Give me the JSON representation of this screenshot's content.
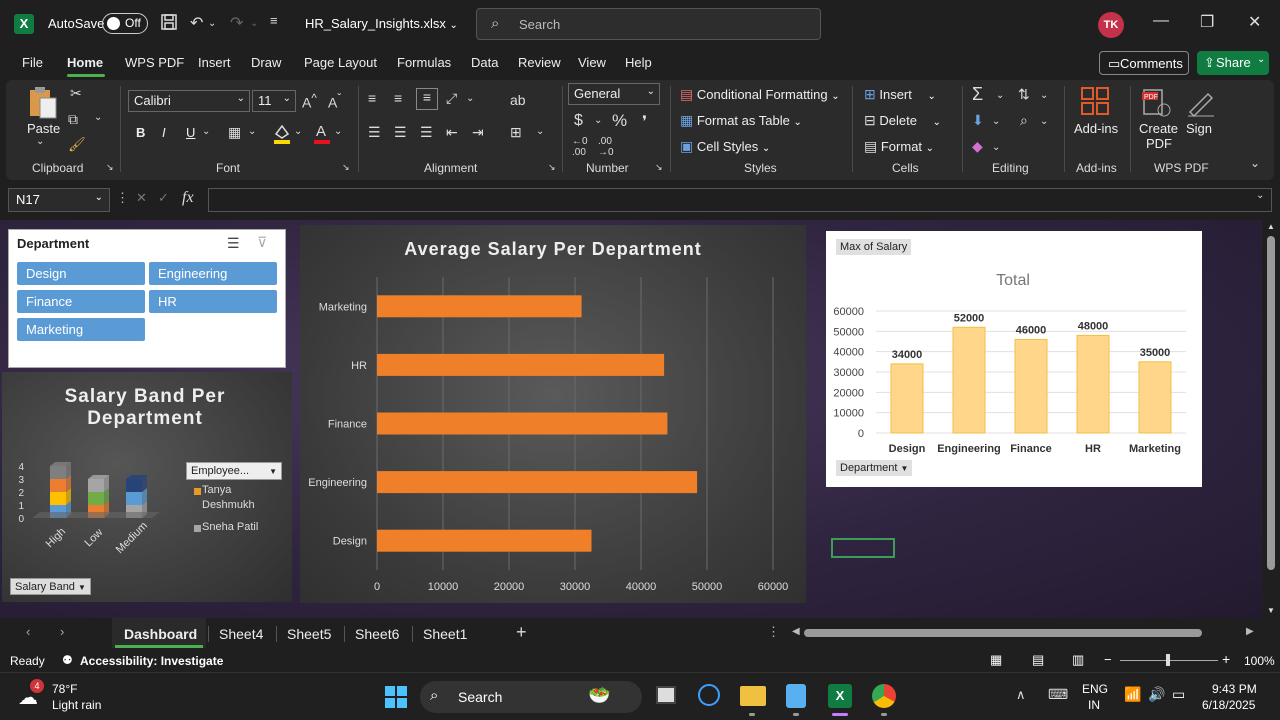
{
  "titlebar": {
    "autosave_label": "AutoSave",
    "autosave_state": "Off",
    "filename": "HR_Salary_Insights.xlsx",
    "search_placeholder": "Search",
    "avatar_initials": "TK"
  },
  "menu": {
    "items": [
      "File",
      "Home",
      "WPS PDF",
      "Insert",
      "Draw",
      "Page Layout",
      "Formulas",
      "Data",
      "Review",
      "View",
      "Help"
    ],
    "active": "Home",
    "comments_label": "Comments",
    "share_label": "Share"
  },
  "ribbon": {
    "clipboard": {
      "paste": "Paste",
      "label": "Clipboard"
    },
    "font": {
      "name": "Calibri",
      "size": "11",
      "label": "Font",
      "bold": "B",
      "italic": "I",
      "underline": "U"
    },
    "alignment": {
      "label": "Alignment"
    },
    "number": {
      "format": "General",
      "label": "Number"
    },
    "styles": {
      "conditional": "Conditional Formatting",
      "table": "Format as Table",
      "cell": "Cell Styles",
      "label": "Styles"
    },
    "cells": {
      "insert": "Insert",
      "delete": "Delete",
      "format": "Format",
      "label": "Cells"
    },
    "editing": {
      "label": "Editing"
    },
    "addins": {
      "button": "Add-ins",
      "label": "Add-ins"
    },
    "wpspdf": {
      "create": "Create",
      "pdf": "PDF",
      "sign": "Sign",
      "label": "WPS PDF"
    }
  },
  "formula_bar": {
    "name_box": "N17",
    "fx": "fx",
    "content": ""
  },
  "slicer": {
    "title": "Department",
    "items": [
      "Design",
      "Engineering",
      "Finance",
      "HR",
      "Marketing"
    ]
  },
  "chart1": {
    "title_line1": "Salary Band Per",
    "title_line2": "Department",
    "filter_label": "Employee...",
    "legend": [
      "Tanya",
      "Deshmukh",
      "Sneha Patil"
    ],
    "field_button": "Salary Band"
  },
  "chart3": {
    "field_button_top": "Max of Salary",
    "field_button_bottom": "Department"
  },
  "chart_data": [
    {
      "type": "bar",
      "orientation": "horizontal",
      "title": "Average Salary Per Department",
      "categories": [
        "Marketing",
        "HR",
        "Finance",
        "Engineering",
        "Design"
      ],
      "values": [
        31000,
        43500,
        44000,
        48500,
        32500
      ],
      "xlim": [
        0,
        60000
      ],
      "ticks": [
        "0",
        "10000",
        "20000",
        "30000",
        "40000",
        "50000",
        "60000"
      ],
      "bar_color": "#f07f2a",
      "grid": true
    },
    {
      "type": "bar",
      "title": "Total",
      "categories": [
        "Design",
        "Engineering",
        "Finance",
        "HR",
        "Marketing"
      ],
      "values": [
        34000,
        52000,
        46000,
        48000,
        35000
      ],
      "ylim": [
        0,
        60000
      ],
      "ticks": [
        "0",
        "10000",
        "20000",
        "30000",
        "40000",
        "50000",
        "60000"
      ],
      "bar_color": "#ffd68a",
      "grid": true
    },
    {
      "type": "bar",
      "stacked": true,
      "three_d": true,
      "categories": [
        "High",
        "Low",
        "Medium"
      ],
      "series_colors": [
        "#5b9bd5",
        "#ffc000",
        "#ed7d31",
        "#a5a5a5",
        "#70ad47",
        "#264478",
        "#7f7f7f"
      ],
      "ylim": [
        0,
        4
      ],
      "ticks": [
        "0",
        "1",
        "2",
        "3",
        "4"
      ],
      "legend_colors": [
        "#e59a2a",
        "#a5a5a5"
      ]
    }
  ],
  "tabs": {
    "items": [
      "Dashboard",
      "Sheet4",
      "Sheet5",
      "Sheet6",
      "Sheet1"
    ],
    "active": "Dashboard"
  },
  "status": {
    "ready": "Ready",
    "accessibility": "Accessibility: Investigate",
    "zoom": "100%"
  },
  "taskbar": {
    "weather_temp": "78°F",
    "weather_desc": "Light rain",
    "weather_badge": "4",
    "search": "Search",
    "lang1": "ENG",
    "lang2": "IN",
    "time": "9:43 PM",
    "date": "6/18/2025"
  }
}
